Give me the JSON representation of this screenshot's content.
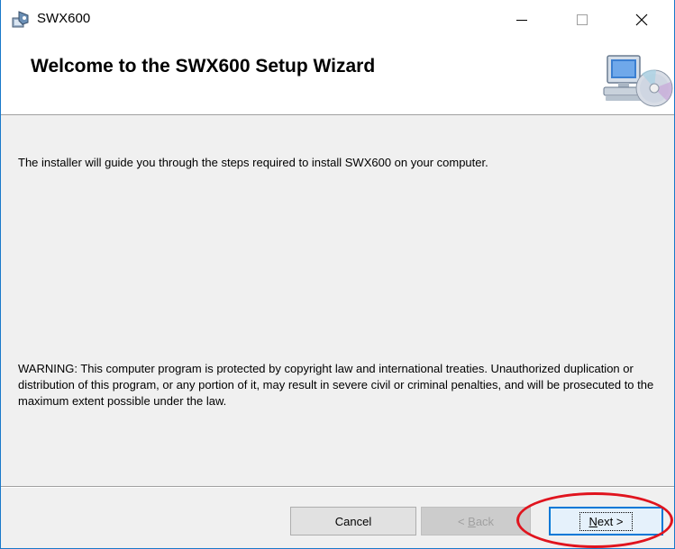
{
  "window": {
    "title": "SWX600",
    "minimize_glyph": "—",
    "maximize_glyph": "☐",
    "close_glyph": "✕"
  },
  "header": {
    "title": "Welcome to the SWX600 Setup Wizard",
    "graphic_icon": "computer-cd-icon"
  },
  "content": {
    "intro": "The installer will guide you through the steps required to install SWX600 on your computer.",
    "warning": "WARNING: This computer program is protected by copyright law and international treaties. Unauthorized duplication or distribution of this program, or any portion of it, may result in severe civil or criminal penalties, and will be prosecuted to the maximum extent possible under the law."
  },
  "buttons": {
    "cancel": "Cancel",
    "back_mnemonic": "B",
    "back_rest": "ack",
    "back_prefix": "< ",
    "next_mnemonic": "N",
    "next_rest": "ext >"
  },
  "colors": {
    "accent": "#0078d7",
    "highlight": "#e0141e",
    "window_border": "#1979ca"
  }
}
